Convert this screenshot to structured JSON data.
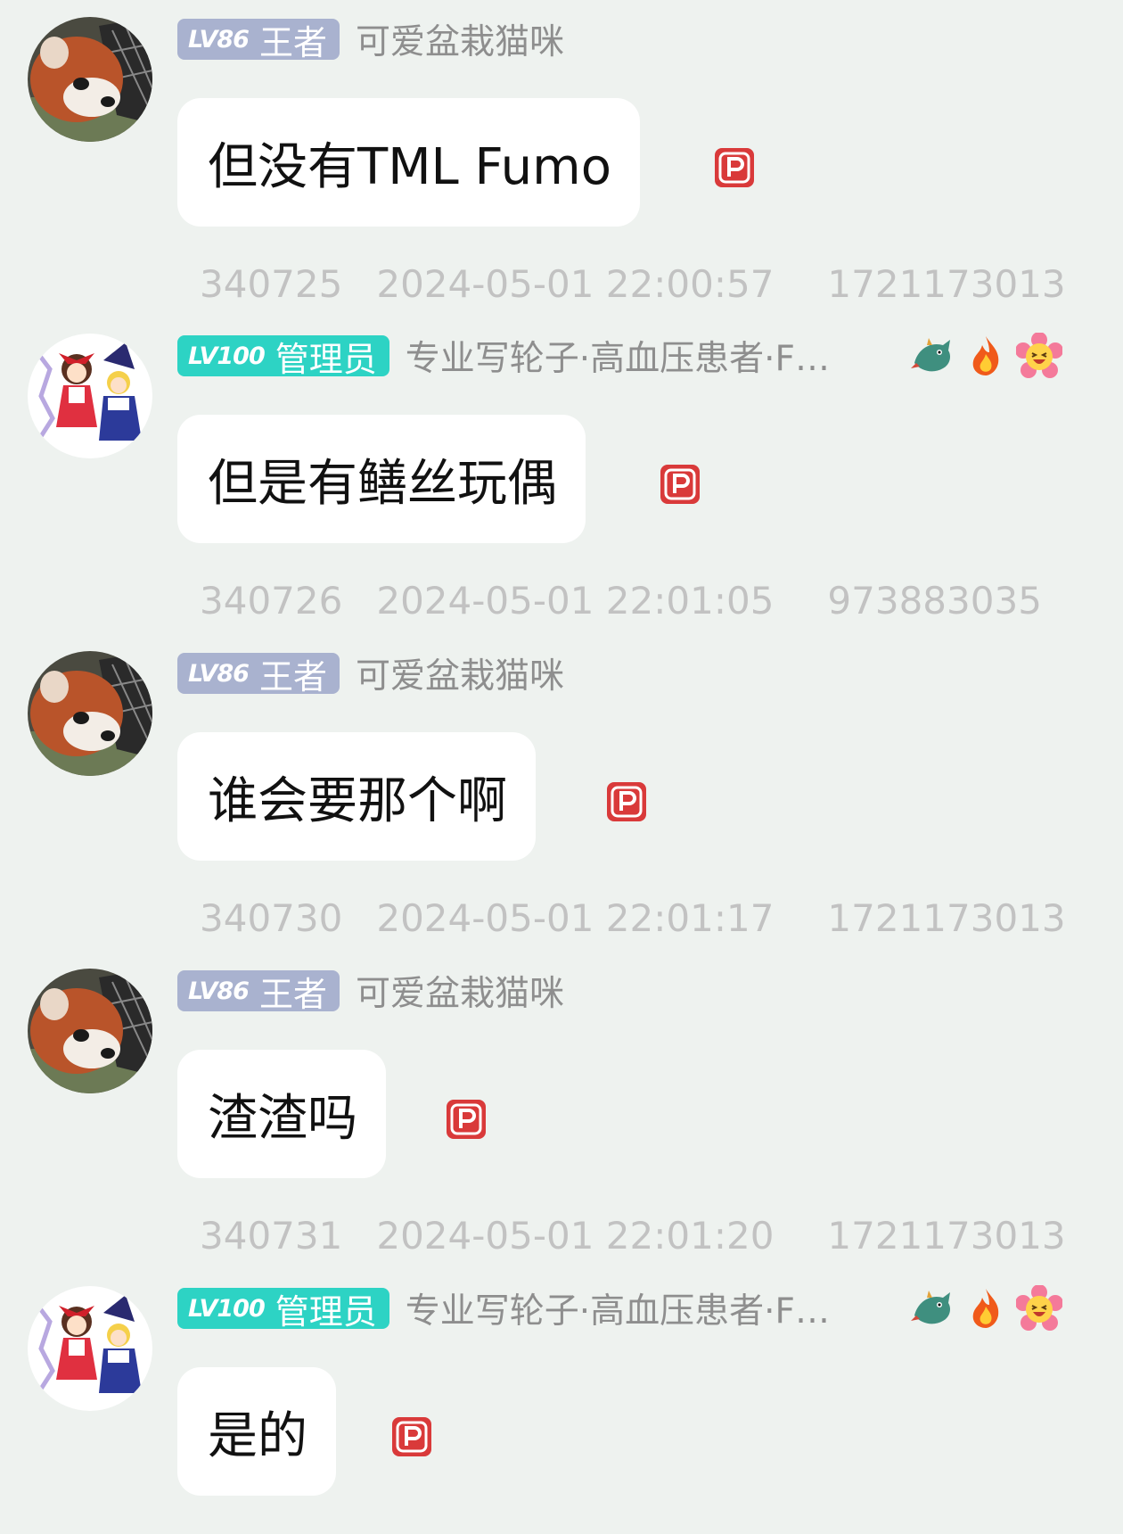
{
  "messages": [
    {
      "level": "LV86",
      "title": "王者",
      "nickname": "可爱盆栽猫咪",
      "text": "但没有TML Fumo",
      "msg_id": "340725",
      "time": "2024-05-01 22:00:57",
      "user_id": "1721173013",
      "avatar": "red-panda-avatar"
    },
    {
      "level": "LV100",
      "title": "管理员",
      "nickname": "专业写轮子·高血压患者·F…",
      "text": "但是有鳝丝玩偶",
      "msg_id": "340726",
      "time": "2024-05-01 22:01:05",
      "user_id": "973883035",
      "avatar": "anime-characters-avatar",
      "emojis": [
        "dragon-emoji-icon",
        "fire-emoji-icon",
        "laughing-flower-emoji-icon"
      ]
    },
    {
      "level": "LV86",
      "title": "王者",
      "nickname": "可爱盆栽猫咪",
      "text": "谁会要那个啊",
      "msg_id": "340730",
      "time": "2024-05-01 22:01:17",
      "user_id": "1721173013",
      "avatar": "red-panda-avatar"
    },
    {
      "level": "LV86",
      "title": "王者",
      "nickname": "可爱盆栽猫咪",
      "text": "渣渣吗",
      "msg_id": "340731",
      "time": "2024-05-01 22:01:20",
      "user_id": "1721173013",
      "avatar": "red-panda-avatar"
    },
    {
      "level": "LV100",
      "title": "管理员",
      "nickname": "专业写轮子·高血压患者·F…",
      "text": "是的",
      "avatar": "anime-characters-avatar",
      "emojis": [
        "dragon-emoji-icon",
        "fire-emoji-icon",
        "laughing-flower-emoji-icon"
      ]
    }
  ],
  "colors": {
    "background": "#eef2ef",
    "lv86_badge": "#a9b2cf",
    "lv100_badge": "#2dd3c4",
    "bubble": "#ffffff",
    "meta_text": "#c2c2c2",
    "nickname_text": "#8e8e8e",
    "p_icon": "#d93a3a"
  },
  "icons": {
    "message_status": "p-icon"
  }
}
